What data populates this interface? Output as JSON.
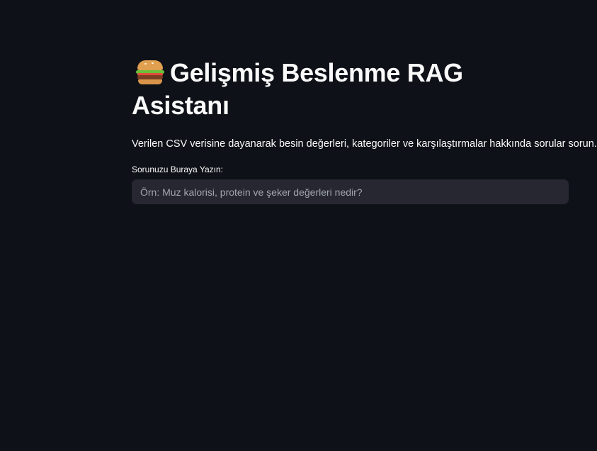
{
  "page": {
    "title": "Gelişmiş Beslenme RAG Asistanı",
    "title_icon": "hamburger-emoji",
    "description": "Verilen CSV verisine dayanarak besin değerleri, kategoriler ve karşılaştırmalar hakkında sorular sorun."
  },
  "question_input": {
    "label": "Sorunuzu Buraya Yazın:",
    "value": "",
    "placeholder": "Örn: Muz kalorisi, protein ve şeker değerleri nedir?"
  },
  "colors": {
    "background": "#0e1117",
    "input_background": "#262730",
    "text": "#fafafa",
    "placeholder": "#a3a6ad"
  }
}
